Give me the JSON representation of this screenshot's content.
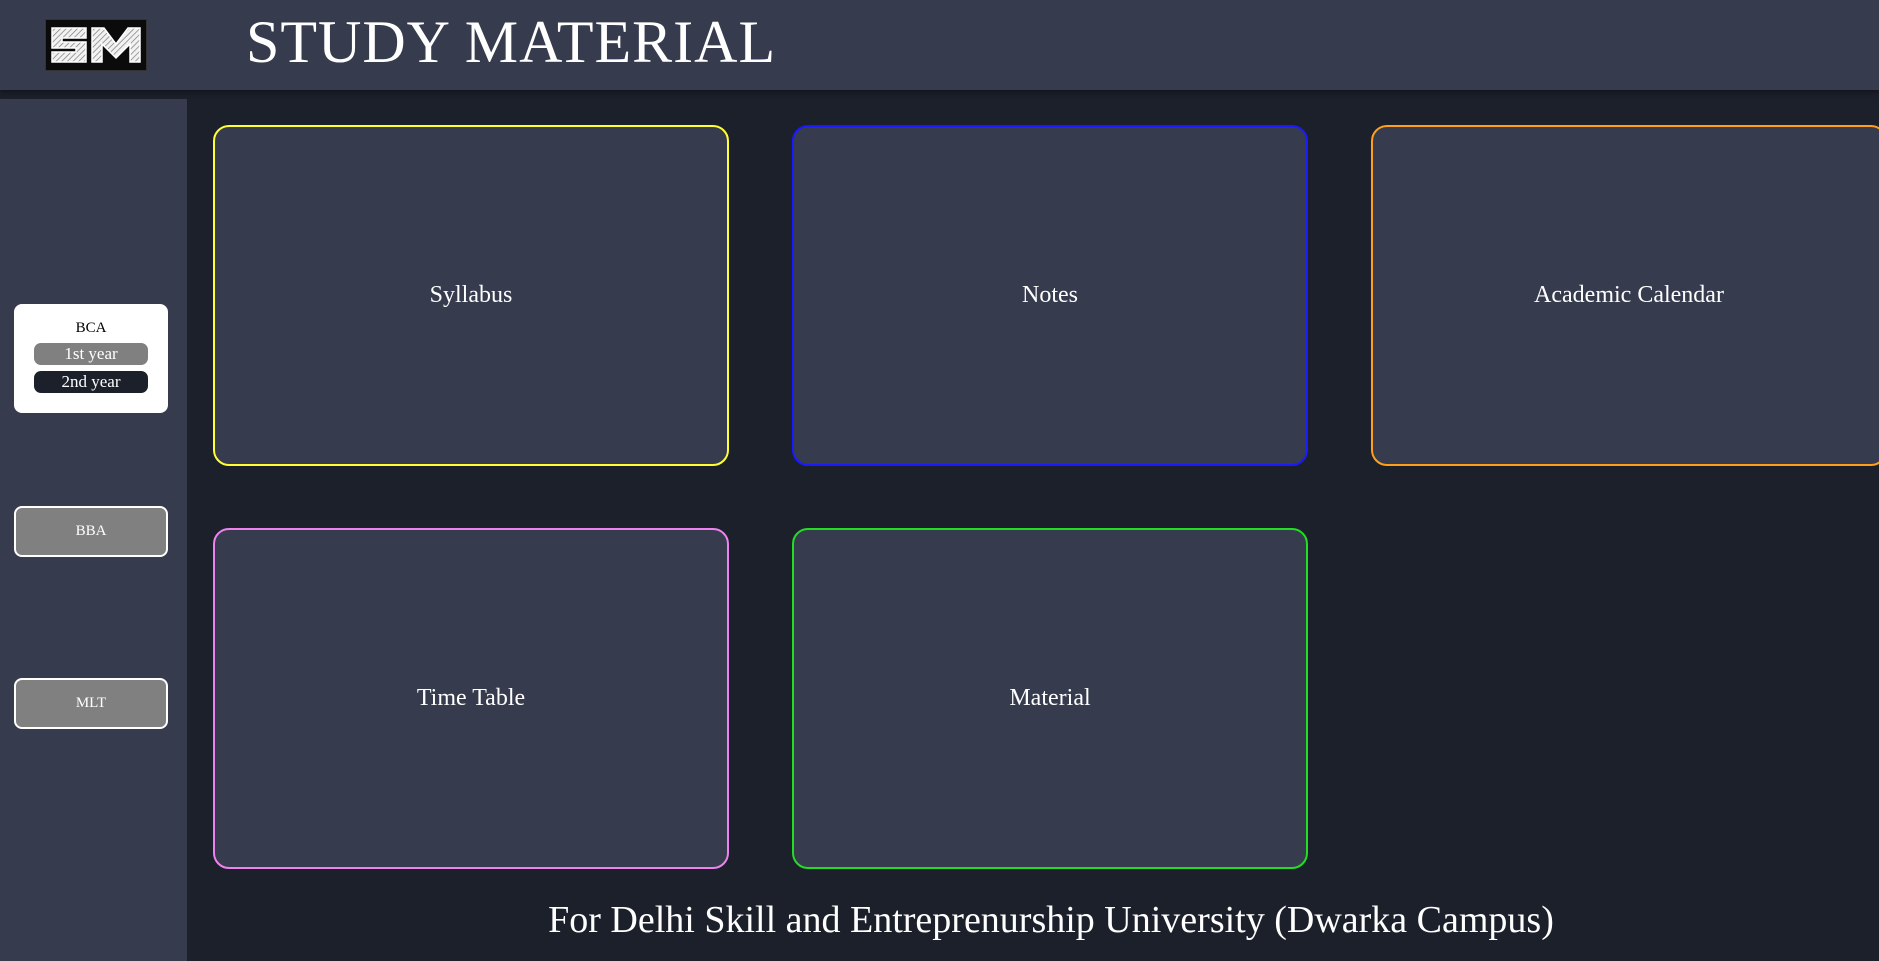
{
  "header": {
    "logo_text": "SM",
    "title": "STUDY MATERIAL"
  },
  "sidebar": {
    "active_course": {
      "label": "BCA",
      "years": [
        "1st year",
        "2nd year"
      ]
    },
    "courses": [
      "BBA",
      "MLT"
    ]
  },
  "tiles": [
    {
      "label": "Syllabus",
      "border_color": "#ffff33"
    },
    {
      "label": "Notes",
      "border_color": "#1a1aff"
    },
    {
      "label": "Academic Calendar",
      "border_color": "#ff9f1a"
    },
    {
      "label": "Time Table",
      "border_color": "#ee82ee"
    },
    {
      "label": "Material",
      "border_color": "#22dd22"
    }
  ],
  "footer": {
    "text": "For Delhi Skill and Entreprenurship University (Dwarka Campus)"
  },
  "colors": {
    "background": "#1c202b",
    "panel": "#363b4e",
    "button_gray": "#808080"
  }
}
